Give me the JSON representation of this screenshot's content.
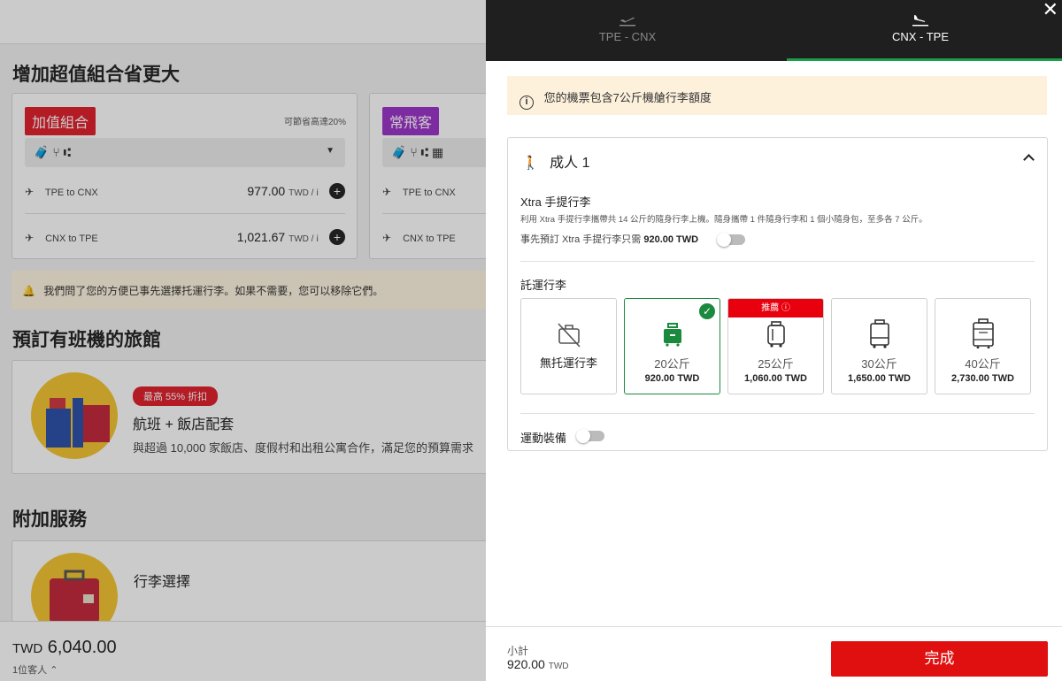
{
  "background": {
    "combo_section_title": "增加超值組合省更大",
    "combo_card": {
      "tag": "加值組合",
      "tag_color": "#e01e2b",
      "save_note": "可節省高達20%",
      "route1": {
        "label": "TPE to CNX",
        "price": "977.00",
        "unit": "TWD / ⅰ"
      },
      "route2": {
        "label": "CNX to TPE",
        "price": "1,021.67",
        "unit": "TWD / ⅰ"
      }
    },
    "frequent_card": {
      "tag": "常飛客",
      "tag_color": "#9c33c9",
      "route1": {
        "label": "TPE to CNX"
      },
      "route2": {
        "label": "CNX to TPE"
      }
    },
    "notice_text": "我們問了您的方便已事先選擇托運行李。如果不需要，您可以移除它們。",
    "hotel_section_title": "預訂有班機的旅館",
    "hotel_card": {
      "badge": "最高 55% 折扣",
      "title": "航班 + 飯店配套",
      "desc": "與超過 10,000 家飯店、度假村和出租公寓合作，滿足您的預算需求"
    },
    "addon_section_title": "附加服務",
    "addon_card": {
      "title": "行李選擇"
    },
    "total": {
      "currency": "TWD",
      "amount": "6,040.00",
      "guests": "1位客人"
    }
  },
  "panel": {
    "tabs": [
      {
        "label": "TPE - CNX",
        "icon": "plane-takeoff-icon",
        "active": false
      },
      {
        "label": "CNX - TPE",
        "icon": "plane-landing-icon",
        "active": true
      }
    ],
    "accent_color": "#1a9e4a",
    "info_text": "您的機票包含7公斤機艙行李額度",
    "passenger": {
      "label": "成人 1",
      "xtra_title": "Xtra 手提行李",
      "xtra_desc": "利用 Xtra 手提行李攜帶共 14 公斤的隨身行李上機。隨身攜帶 1 件隨身行李和 1 個小隨身包，至多各 7 公斤。",
      "xtra_pre_text": "事先預訂 Xtra 手提行李只需",
      "xtra_price": "920.00 TWD",
      "baggage_title": "託運行李",
      "options": [
        {
          "label": "無托運行李",
          "price": "",
          "selected": false,
          "recommended": false
        },
        {
          "label": "20公斤",
          "price": "920.00 TWD",
          "selected": true,
          "recommended": false
        },
        {
          "label": "25公斤",
          "price": "1,060.00 TWD",
          "selected": false,
          "recommended": true
        },
        {
          "label": "30公斤",
          "price": "1,650.00 TWD",
          "selected": false,
          "recommended": false
        },
        {
          "label": "40公斤",
          "price": "2,730.00 TWD",
          "selected": false,
          "recommended": false
        }
      ],
      "recommended_label": "推薦",
      "sport_label": "運動裝備"
    },
    "footer": {
      "subtotal_label": "小計",
      "subtotal_value": "920.00",
      "subtotal_currency": "TWD",
      "done_label": "完成",
      "done_color": "#e01010"
    }
  }
}
